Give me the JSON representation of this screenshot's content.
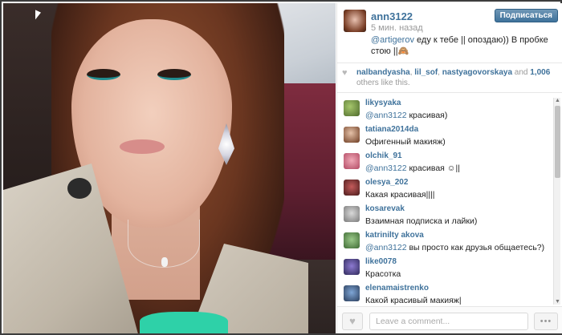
{
  "post": {
    "username": "ann3122",
    "time": "5 мин. назад",
    "caption_mention": "@artigerov",
    "caption_text": " еду к тебе || опоздаю)) В пробке стою ||🙈",
    "follow_label": "Подписаться"
  },
  "likes": {
    "liker_1": "nalbandyasha",
    "liker_2": "lil_sof",
    "liker_3": "nastyagovorskaya",
    "and_text": " and ",
    "count": "1,006",
    "suffix": " others like this."
  },
  "comments": [
    {
      "user": "likysyaka",
      "mention": "@ann3122",
      "text": " красивая)"
    },
    {
      "user": "tatiana2014da",
      "mention": "",
      "text": "Офигенный макияж)"
    },
    {
      "user": "olchik_91",
      "mention": "@ann3122",
      "text": " красивая ☺||"
    },
    {
      "user": "olesya_202",
      "mention": "",
      "text": "Какая красивая||||"
    },
    {
      "user": "kosarevak",
      "mention": "",
      "text": "Взаимная подписка и лайки)"
    },
    {
      "user": "katrinilty akova",
      "mention": "@ann3122",
      "text": " вы просто как друзья общаетесь?)"
    },
    {
      "user": "like0078",
      "mention": "",
      "text": "Красотка"
    },
    {
      "user": "elenamaistrenko",
      "mention": "",
      "text": "Какой красивый макияж|"
    }
  ],
  "footer": {
    "comment_placeholder": "Leave a comment...",
    "more_label": "•••"
  },
  "icons": {
    "heart": "heart-icon",
    "more": "more-icon"
  },
  "colors": {
    "link_blue": "#3f729b",
    "button_blue": "#3f729b"
  }
}
